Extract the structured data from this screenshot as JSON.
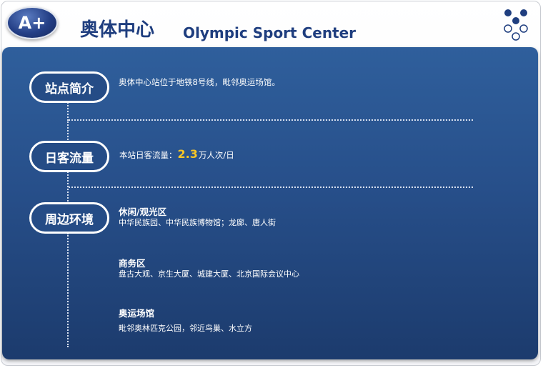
{
  "header": {
    "badge": "A+",
    "title_cn": "奥体中心",
    "title_en": "Olympic Sport Center"
  },
  "sections": {
    "intro": {
      "label": "站点简介",
      "text": "奥体中心站位于地铁8号线，毗邻奥运场馆。"
    },
    "flow": {
      "label": "日客流量",
      "prefix": "本站日客流量：",
      "value": "2.3",
      "suffix": "万人次/日"
    },
    "surroundings": {
      "label": "周边环境",
      "groups": [
        {
          "title": "休闲/观光区",
          "text": "中华民族园、中华民族博物馆；龙廊、唐人街"
        },
        {
          "title": "商务区",
          "text": "盘古大观、京生大厦、城建大厦、北京国际会议中心"
        },
        {
          "title": "奥运场馆",
          "text": "毗邻奥林匹克公园，邻近鸟巢、水立方"
        }
      ]
    }
  },
  "colors": {
    "panel": "#274f8a",
    "title": "#1f3e7f",
    "highlight": "#f7c625",
    "dots": "#1f3e7f"
  },
  "icons": {
    "logo": "dots-logo-icon"
  }
}
